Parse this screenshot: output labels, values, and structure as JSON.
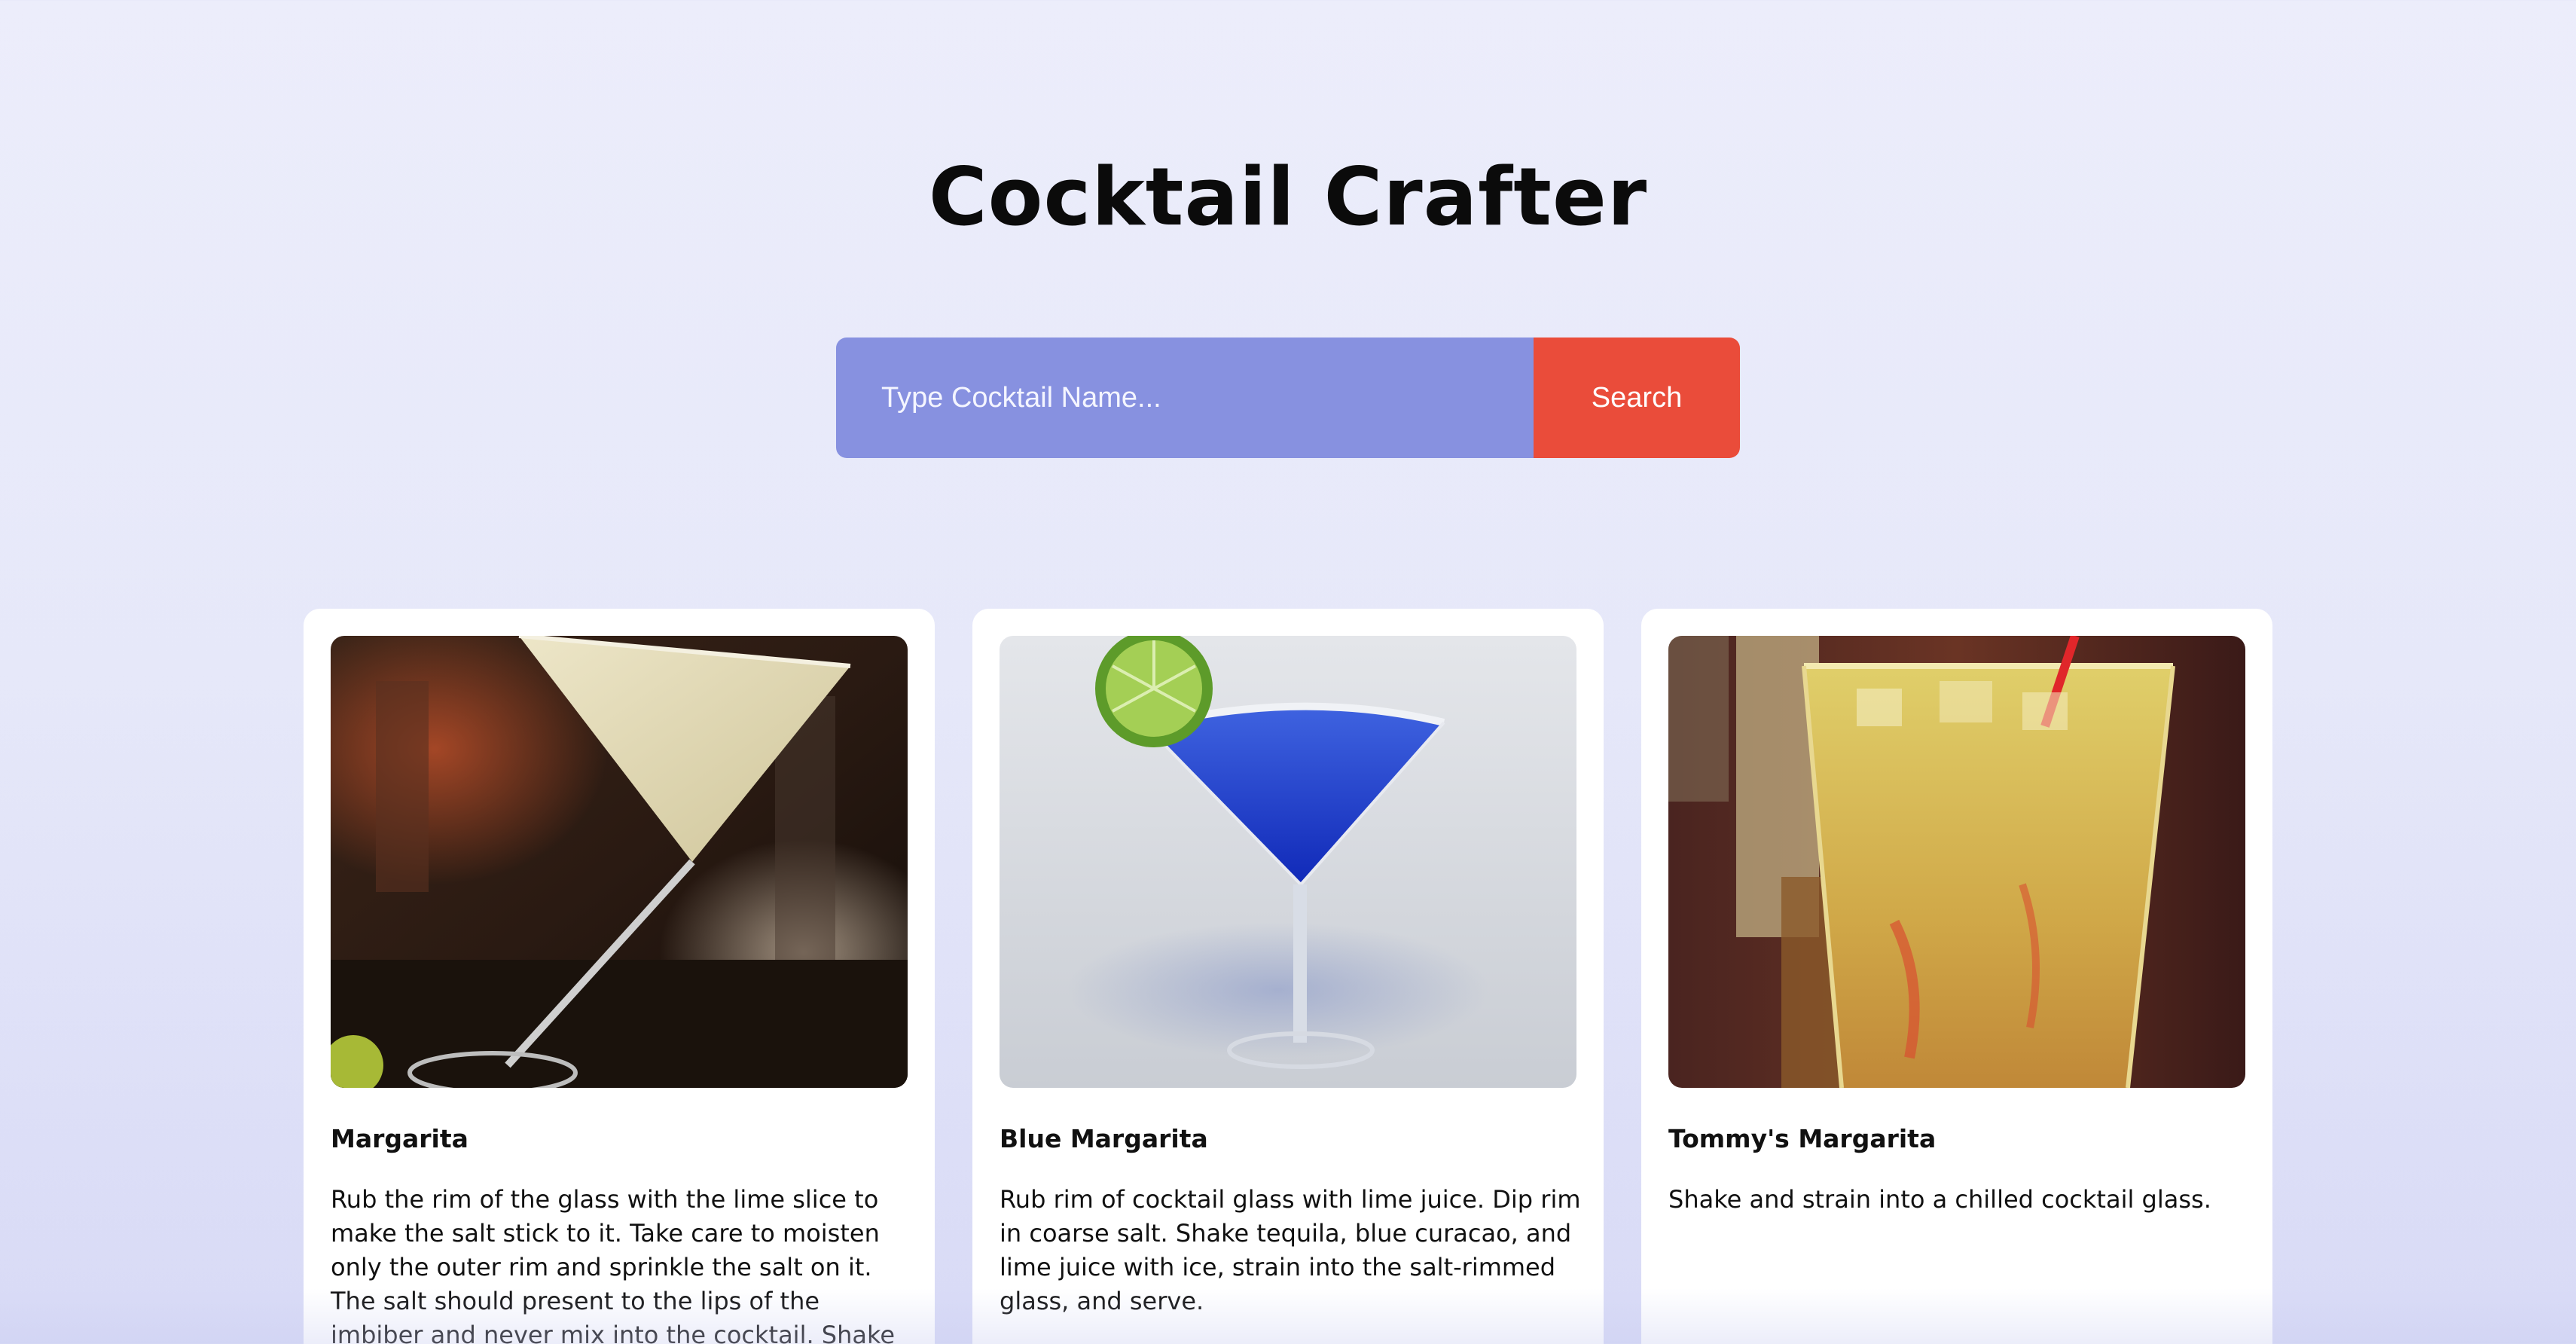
{
  "header": {
    "title": "Cocktail Crafter"
  },
  "search": {
    "placeholder": "Type Cocktail Name...",
    "value": "",
    "button_label": "Search"
  },
  "colors": {
    "input_background": "#8791e0",
    "button_background": "#ea4c3a",
    "page_background": "#e6e8f9",
    "card_background": "#ffffff"
  },
  "cocktails": [
    {
      "name": "Margarita",
      "image": "margarita-photo",
      "instructions": "Rub the rim of the glass with the lime slice to make the salt stick to it. Take care to moisten only the outer rim and sprinkle the salt on it. The salt should present to the lips of the imbiber and never mix into the cocktail. Shake the other ingredients with"
    },
    {
      "name": "Blue Margarita",
      "image": "blue-margarita-photo",
      "instructions": "Rub rim of cocktail glass with lime juice. Dip rim in coarse salt. Shake tequila, blue curacao, and lime juice with ice, strain into the salt-rimmed glass, and serve."
    },
    {
      "name": "Tommy's Margarita",
      "image": "tommys-margarita-photo",
      "instructions": "Shake and strain into a chilled cocktail glass."
    }
  ]
}
